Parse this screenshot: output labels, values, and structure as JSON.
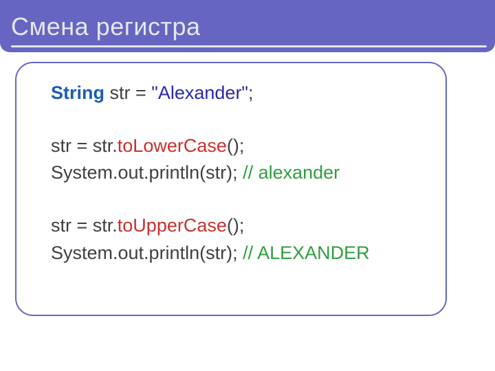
{
  "title": "Смена регистра",
  "code": {
    "l1": {
      "kw": "String",
      "rest1": " str = ",
      "str": "\"Alexander\"",
      "rest2": ";"
    },
    "l2": {
      "pre": "str = str.",
      "method": "toLowerCase",
      "post": "();"
    },
    "l3": {
      "pre": "System.out.println(str); ",
      "comment": "// alexander"
    },
    "l4": {
      "pre": "str = str.",
      "method": "toUpperCase",
      "post": "();"
    },
    "l5": {
      "pre": "System.out.println(str); ",
      "comment": "// ALEXANDER"
    }
  }
}
